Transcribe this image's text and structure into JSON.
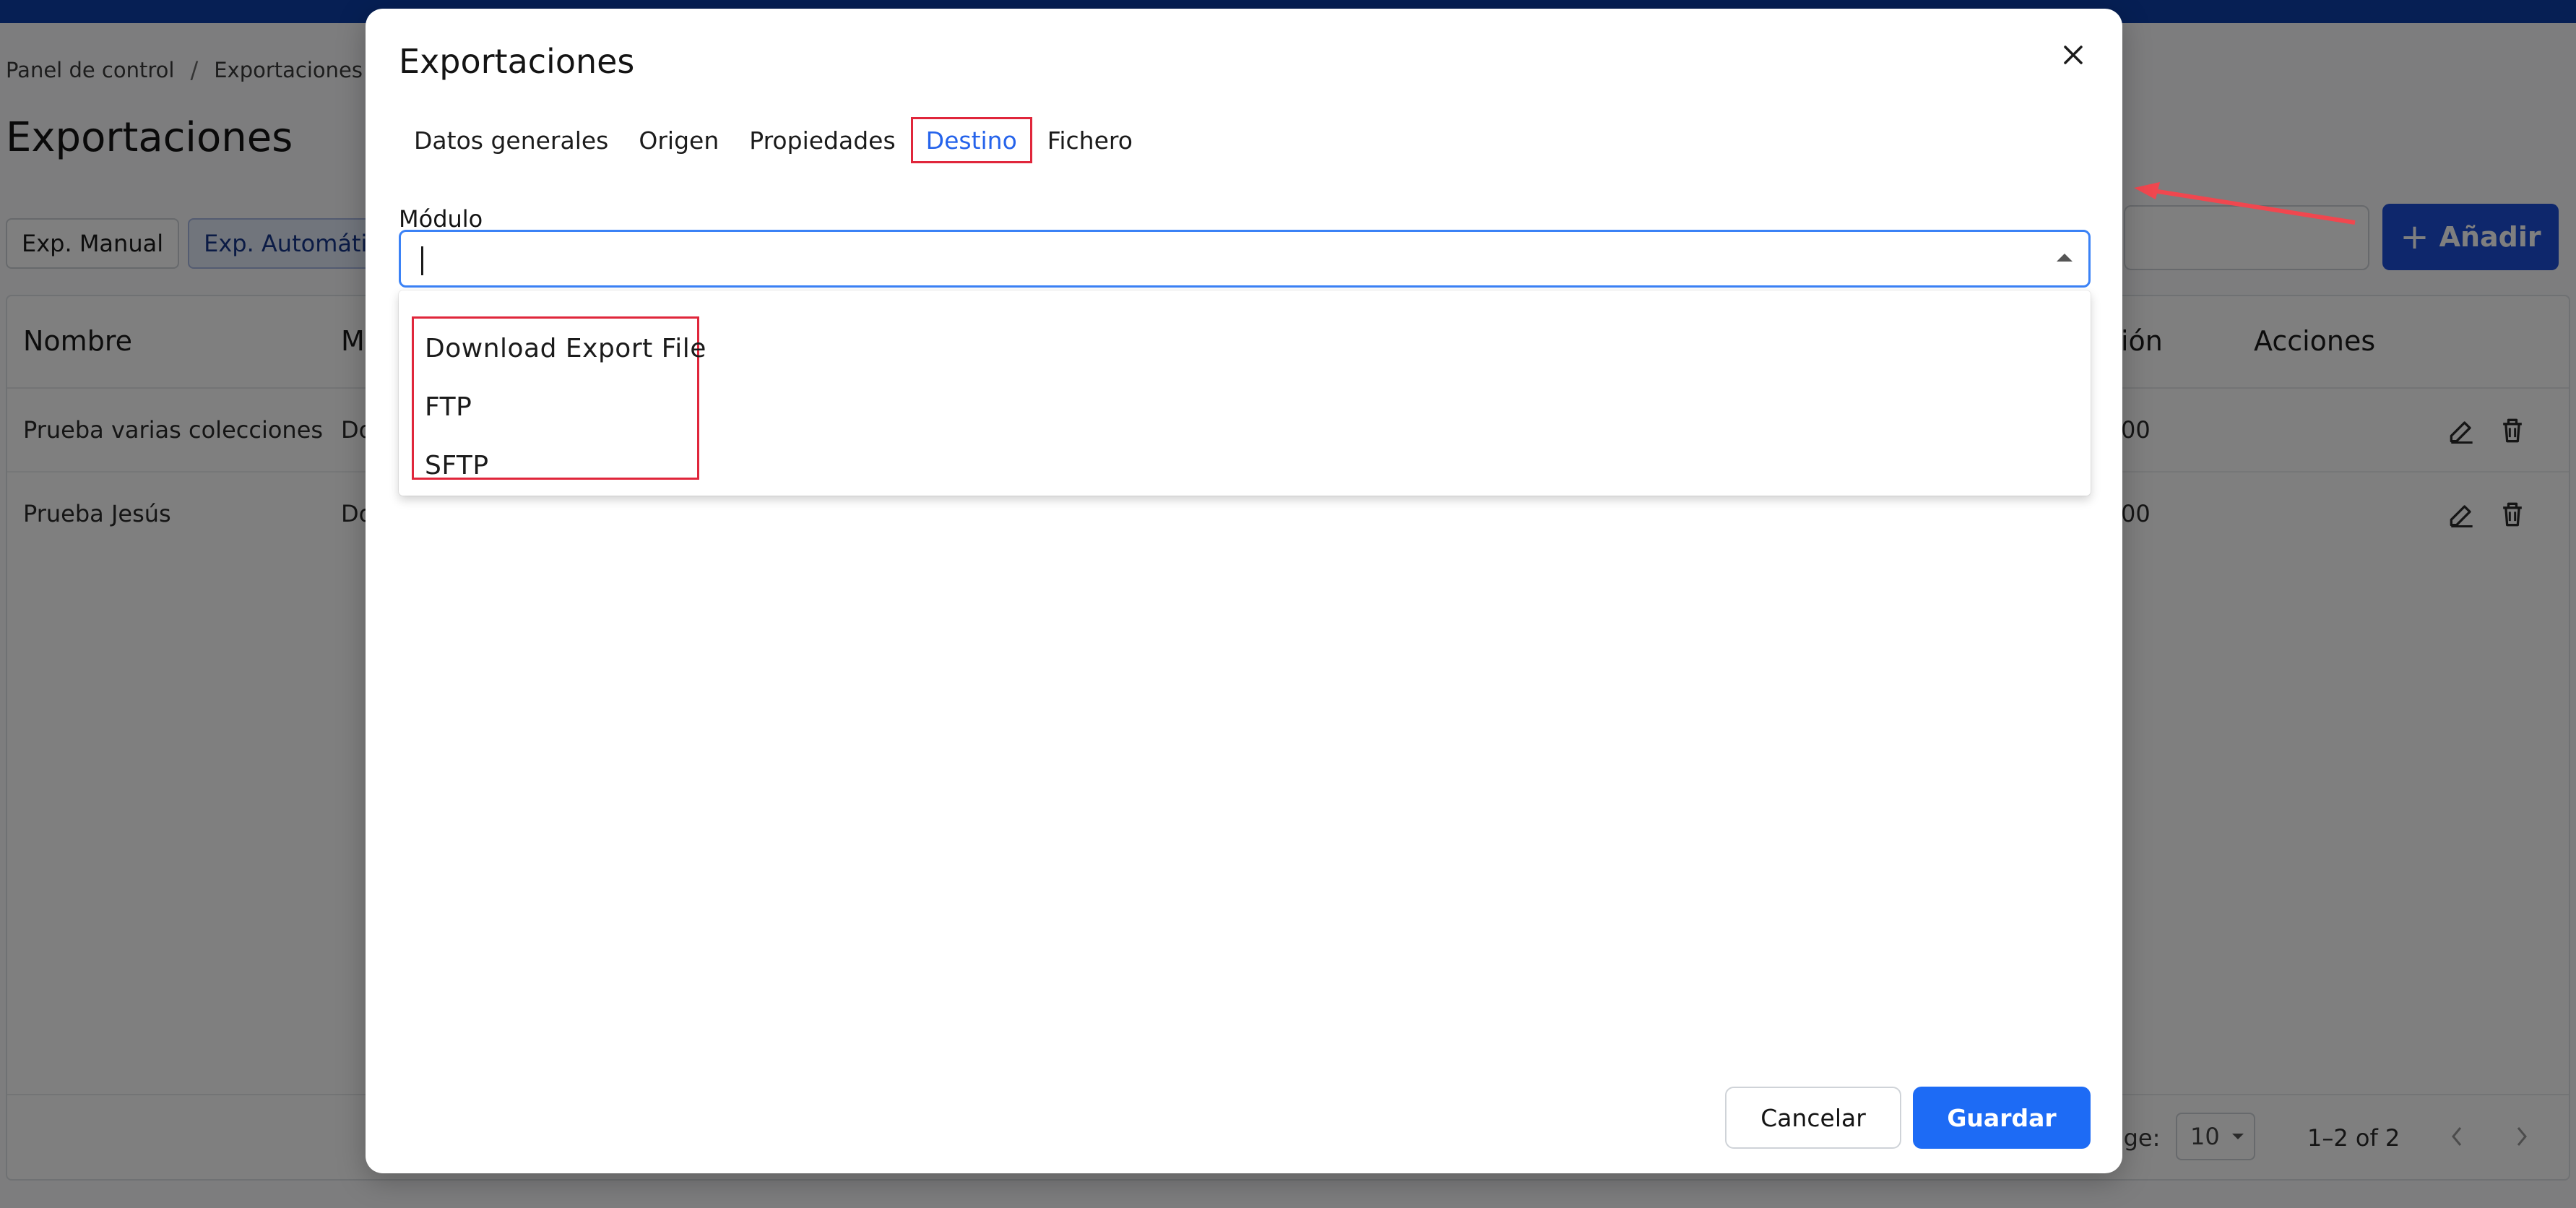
{
  "page": {
    "breadcrumb": [
      "Panel de control",
      "Exportaciones"
    ],
    "breadcrumb_sep": "/",
    "title": "Exportaciones",
    "filters": [
      {
        "label": "Exp. Manual",
        "active": false
      },
      {
        "label": "Exp. Automática",
        "active": true
      }
    ],
    "add_button": {
      "label": "Añadir",
      "icon": "plus-icon"
    },
    "table": {
      "headers": [
        "Nombre",
        "M",
        "ión",
        "Acciones"
      ],
      "rows": [
        {
          "nombre": "Prueba varias colecciones",
          "col2": "Do",
          "col3": "00"
        },
        {
          "nombre": "Prueba Jesús",
          "col2": "Do",
          "col3": "00"
        }
      ],
      "row_actions": [
        "edit-icon",
        "trash-icon"
      ]
    },
    "pagination": {
      "rows_label": "age:",
      "rows_per_page": "10",
      "range": "1–2 of 2"
    }
  },
  "modal": {
    "title": "Exportaciones",
    "tabs": [
      {
        "label": "Datos generales",
        "active": false
      },
      {
        "label": "Origen",
        "active": false
      },
      {
        "label": "Propiedades",
        "active": false
      },
      {
        "label": "Destino",
        "active": true
      },
      {
        "label": "Fichero",
        "active": false
      }
    ],
    "field_label": "Módulo",
    "field_value": "",
    "options": [
      "Download Export File",
      "FTP",
      "SFTP"
    ],
    "cancel_label": "Cancelar",
    "save_label": "Guardar"
  },
  "colors": {
    "topbar": "#0d3fa8",
    "primary": "#1d6bf5",
    "highlight": "#e0263b",
    "active_tab_text": "#2563eb"
  }
}
